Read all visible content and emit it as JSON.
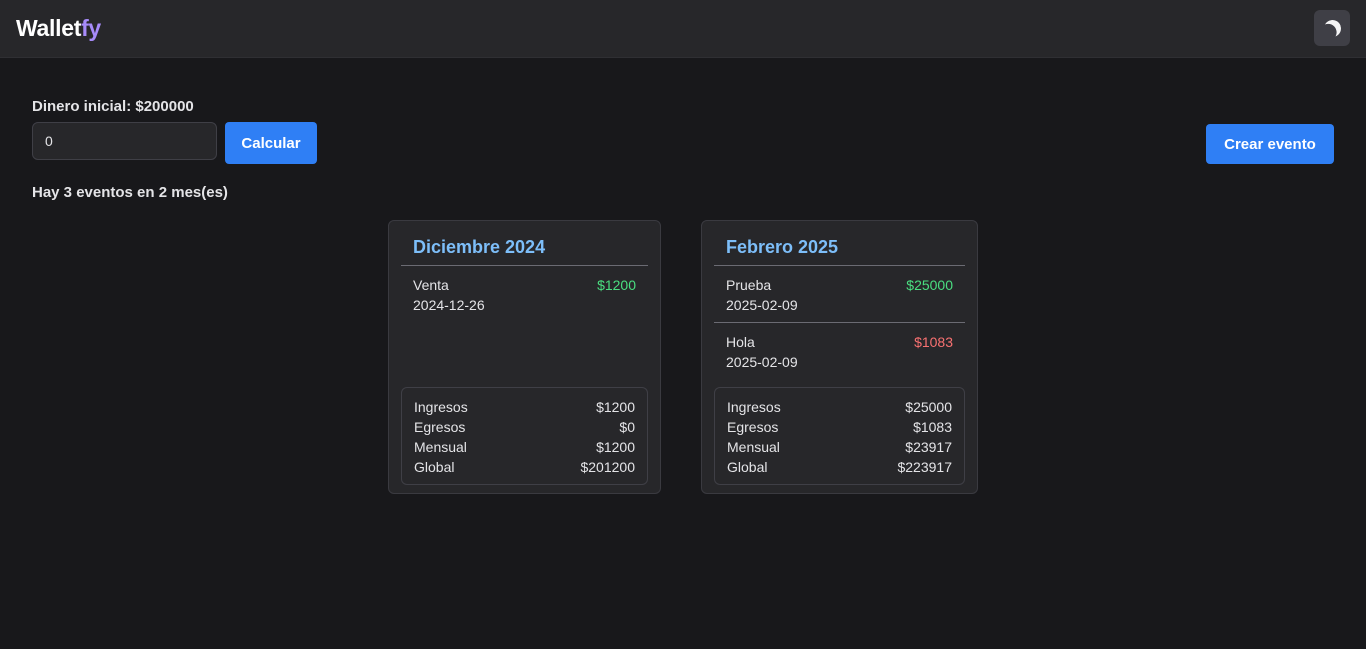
{
  "header": {
    "logo_main": "Wallet",
    "logo_accent": "fy",
    "theme_toggle_icon": "moon-icon"
  },
  "controls": {
    "initial_label": "Dinero inicial: $200000",
    "input_value": "0",
    "calc_label": "Calcular",
    "create_label": "Crear evento",
    "summary": "Hay 3 eventos en 2 mes(es)"
  },
  "colors": {
    "accent": "#2f7ff5",
    "income": "#4ade80",
    "expense": "#f87171",
    "month_title": "#7dbef9",
    "logo_accent": "#a78bfa"
  },
  "months": [
    {
      "title": "Diciembre 2024",
      "events": [
        {
          "name": "Venta",
          "date": "2024-12-26",
          "amount": "$1200",
          "type": "income"
        }
      ],
      "totals": {
        "ingresos_label": "Ingresos",
        "ingresos": "$1200",
        "egresos_label": "Egresos",
        "egresos": "$0",
        "mensual_label": "Mensual",
        "mensual": "$1200",
        "global_label": "Global",
        "global": "$201200"
      }
    },
    {
      "title": "Febrero 2025",
      "events": [
        {
          "name": "Prueba",
          "date": "2025-02-09",
          "amount": "$25000",
          "type": "income"
        },
        {
          "name": "Hola",
          "date": "2025-02-09",
          "amount": "$1083",
          "type": "expense"
        }
      ],
      "totals": {
        "ingresos_label": "Ingresos",
        "ingresos": "$25000",
        "egresos_label": "Egresos",
        "egresos": "$1083",
        "mensual_label": "Mensual",
        "mensual": "$23917",
        "global_label": "Global",
        "global": "$223917"
      }
    }
  ]
}
